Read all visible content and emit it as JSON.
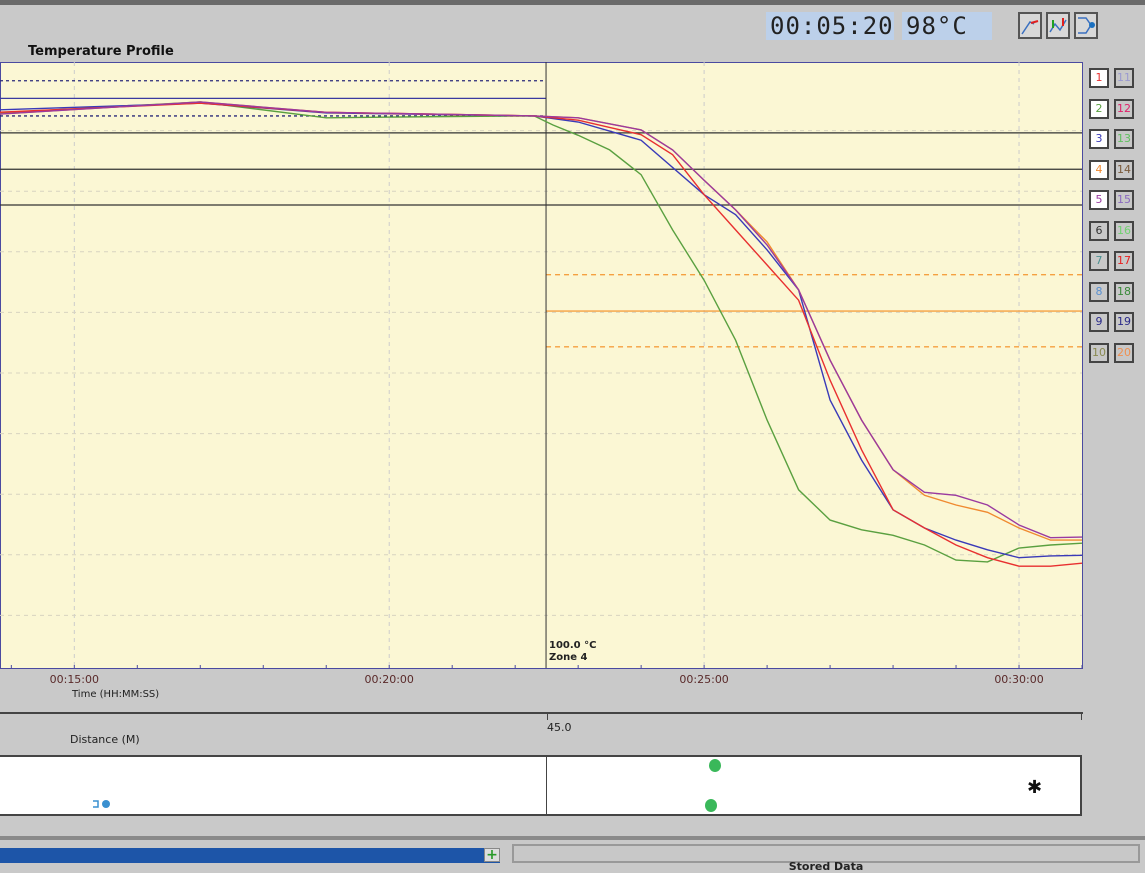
{
  "header": {
    "elapsed_time": "00:05:20",
    "current_temp": "98°C",
    "tools": [
      {
        "icon": "rising-profile-icon"
      },
      {
        "icon": "peak-profile-icon"
      },
      {
        "icon": "connect-probe-icon"
      }
    ]
  },
  "chart_data": {
    "type": "line",
    "title": "Temperature Profile",
    "xlabel": "Time (HH:MM:SS)",
    "ylabel": "",
    "x_units": "minutes",
    "xlim": [
      13.82,
      31.0
    ],
    "ylim": [
      0,
      100
    ],
    "y_scale_note": "",
    "x_ticks": [
      {
        "value": 15,
        "label": "00:15:00"
      },
      {
        "value": 20,
        "label": "00:20:00"
      },
      {
        "value": 25,
        "label": "00:25:00"
      },
      {
        "value": 30,
        "label": "00:30:00"
      }
    ],
    "grid": true,
    "cursor": {
      "x": 22.49,
      "label_temp": "100.0 °C",
      "label_zone": "Zone 4"
    },
    "reference_lines": [
      {
        "y": 96.9,
        "color": "#2a2a7a",
        "style": "dotted",
        "to_x": 22.49
      },
      {
        "y": 94.0,
        "color": "#3a3aa0",
        "style": "solid",
        "to_x": 22.49
      },
      {
        "y": 91.1,
        "color": "#2a2a7a",
        "style": "dotted",
        "to_x": 22.49
      },
      {
        "y": 88.3,
        "color": "#333333",
        "style": "solid"
      },
      {
        "y": 82.3,
        "color": "#333333",
        "style": "solid"
      },
      {
        "y": 76.4,
        "color": "#333333",
        "style": "solid"
      },
      {
        "y": 64.9,
        "color": "#f5a040",
        "style": "dashed",
        "from_x": 22.49
      },
      {
        "y": 58.9,
        "color": "#f5a040",
        "style": "solid",
        "from_x": 22.49
      },
      {
        "y": 53.0,
        "color": "#f5a040",
        "style": "dashed",
        "from_x": 22.49
      }
    ],
    "series": [
      {
        "color": "#5aa040",
        "x": [
          13.8,
          17,
          19,
          21,
          22.3,
          22.6,
          23,
          23.5,
          24,
          24.5,
          25,
          25.5,
          26,
          26.5,
          27,
          27.5,
          28,
          28.5,
          29,
          29.5,
          30,
          30.5,
          31
        ],
        "y": [
          91.6,
          93.4,
          90.8,
          91.0,
          91.1,
          89.6,
          87.9,
          85.5,
          81.4,
          72.3,
          64.0,
          54.1,
          40.9,
          29.4,
          24.4,
          22.8,
          21.9,
          20.3,
          17.8,
          17.5,
          19.8,
          20.3,
          20.6
        ]
      },
      {
        "color": "#3a3ab8",
        "x": [
          13.8,
          17,
          19,
          22.3,
          23,
          24,
          25,
          25.5,
          26,
          26.5,
          27,
          27.5,
          28,
          28.5,
          29,
          29.5,
          30,
          30.5,
          31
        ],
        "y": [
          92.1,
          93.2,
          91.6,
          91.1,
          90.1,
          87.1,
          78.1,
          74.8,
          69.0,
          62.4,
          44.2,
          34.3,
          26.1,
          23.1,
          21.1,
          19.5,
          18.2,
          18.5,
          18.6
        ]
      },
      {
        "color": "#f08a30",
        "x": [
          13.8,
          17,
          19,
          22.3,
          23,
          24,
          24.5,
          25,
          25.5,
          26,
          26.5,
          27,
          27.5,
          28,
          28.5,
          29,
          29.5,
          30,
          30.5,
          31
        ],
        "y": [
          91.4,
          93.4,
          91.7,
          91.1,
          90.8,
          88.8,
          85.5,
          80.5,
          75.6,
          70.3,
          62.4,
          50.8,
          40.9,
          32.7,
          28.5,
          26.9,
          25.7,
          23.1,
          21.1,
          21.1
        ]
      },
      {
        "color": "#e83030",
        "x": [
          13.8,
          17,
          19,
          22.3,
          23,
          24,
          24.5,
          25,
          25.5,
          26,
          26.5,
          27,
          27.5,
          28,
          28.5,
          29,
          29.5,
          30,
          30.5,
          31
        ],
        "y": [
          91.7,
          93.2,
          91.7,
          91.1,
          90.4,
          88.0,
          84.7,
          78.1,
          72.3,
          66.5,
          60.7,
          47.5,
          36.0,
          26.1,
          23.1,
          20.3,
          18.2,
          16.8,
          16.8,
          17.3
        ]
      },
      {
        "color": "#9a3aa0",
        "x": [
          13.8,
          17,
          19,
          22.3,
          23,
          24,
          24.5,
          25,
          25.5,
          26,
          26.5,
          27,
          27.5,
          28,
          28.5,
          29,
          29.5,
          30,
          30.5,
          31
        ],
        "y": [
          91.4,
          93.4,
          91.7,
          91.1,
          90.8,
          88.8,
          85.5,
          80.5,
          75.6,
          69.8,
          62.4,
          50.8,
          40.9,
          32.7,
          29.0,
          28.5,
          26.9,
          23.6,
          21.5,
          21.6
        ]
      }
    ]
  },
  "channels": [
    {
      "n": "1",
      "color": "#e83030",
      "on": true
    },
    {
      "n": "11",
      "color": "#9a9ad0",
      "on": false
    },
    {
      "n": "2",
      "color": "#5aa040",
      "on": true
    },
    {
      "n": "12",
      "color": "#e0206a",
      "on": false
    },
    {
      "n": "3",
      "color": "#3a3ab8",
      "on": true
    },
    {
      "n": "13",
      "color": "#60c060",
      "on": false
    },
    {
      "n": "4",
      "color": "#f08a30",
      "on": true
    },
    {
      "n": "14",
      "color": "#7a5a3a",
      "on": false
    },
    {
      "n": "5",
      "color": "#9a3aa0",
      "on": true
    },
    {
      "n": "15",
      "color": "#8a6ac0",
      "on": false
    },
    {
      "n": "6",
      "color": "#333333",
      "on": false
    },
    {
      "n": "16",
      "color": "#70d070",
      "on": false
    },
    {
      "n": "7",
      "color": "#4a9090",
      "on": false
    },
    {
      "n": "17",
      "color": "#e82020",
      "on": false
    },
    {
      "n": "8",
      "color": "#5a90d0",
      "on": false
    },
    {
      "n": "18",
      "color": "#3a8a3a",
      "on": false
    },
    {
      "n": "9",
      "color": "#2a2a8a",
      "on": false
    },
    {
      "n": "19",
      "color": "#2a2a8a",
      "on": false
    },
    {
      "n": "10",
      "color": "#8a8a50",
      "on": false
    },
    {
      "n": "20",
      "color": "#f09050",
      "on": false
    }
  ],
  "distance": {
    "label": "Distance (M)",
    "value": "45.0"
  },
  "bottom": {
    "panel_title": "Stored Data"
  }
}
